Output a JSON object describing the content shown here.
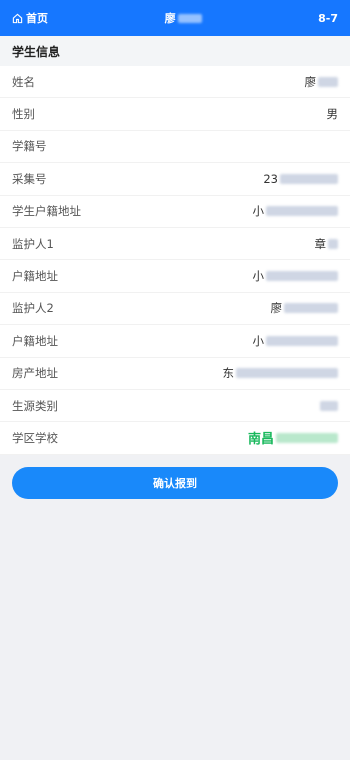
{
  "topbar": {
    "home_label": "首页",
    "title_visible": "廖",
    "right_text": "8-7"
  },
  "section_title": "学生信息",
  "rows": [
    {
      "label": "姓名",
      "value": "廖",
      "blurred": true
    },
    {
      "label": "性别",
      "value": "男",
      "blurred": false
    },
    {
      "label": "学籍号",
      "value": "",
      "blurred": false
    },
    {
      "label": "采集号",
      "value": "23",
      "blurred": true
    },
    {
      "label": "学生户籍地址",
      "value": "小",
      "blurred": true
    },
    {
      "label": "监护人1",
      "value": "章",
      "blurred": true
    },
    {
      "label": "户籍地址",
      "value": "小",
      "blurred": true
    },
    {
      "label": "监护人2",
      "value": "廖",
      "blurred": true
    },
    {
      "label": "户籍地址",
      "value": "小",
      "blurred": true
    },
    {
      "label": "房产地址",
      "value": "东",
      "blurred": true
    },
    {
      "label": "生源类别",
      "value": "",
      "blurred": true
    },
    {
      "label": "学区学校",
      "value": "南昌",
      "blurred": true
    }
  ],
  "confirm_button": "确认报到",
  "colors": {
    "header": "#1677ff",
    "button": "#1989fa",
    "school_text": "#18b85c"
  }
}
